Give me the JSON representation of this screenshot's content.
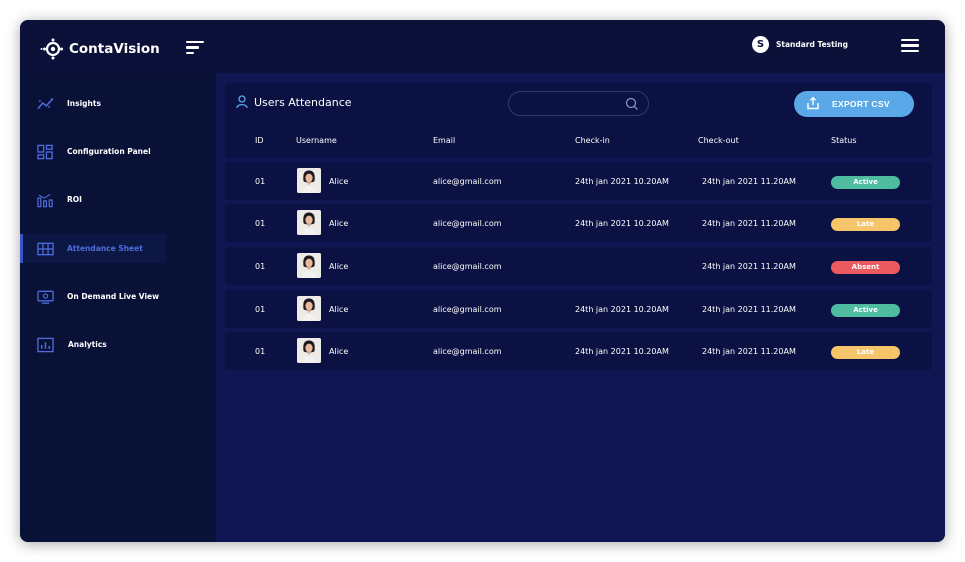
{
  "app": {
    "name": "ContaVision"
  },
  "user": {
    "initial": "S",
    "name": "Standard Testing"
  },
  "sidebar": {
    "items": [
      {
        "label": "Insights",
        "icon": "insights-icon",
        "active": false
      },
      {
        "label": "Configuration Panel",
        "icon": "configuration-icon",
        "active": false
      },
      {
        "label": "ROI",
        "icon": "roi-icon",
        "active": false
      },
      {
        "label": "Attendance Sheet",
        "icon": "attendance-grid-icon",
        "active": true
      },
      {
        "label": "On  Demand Live View",
        "icon": "live-view-icon",
        "active": false
      },
      {
        "label": "Analytics",
        "icon": "analytics-icon",
        "active": false
      }
    ]
  },
  "main": {
    "title": "Users Attendance",
    "search": {
      "placeholder": "",
      "value": ""
    },
    "export_label": "EXPORT CSV",
    "columns": [
      "ID",
      "Username",
      "Email",
      "Check-in",
      "Check-out",
      "Status"
    ],
    "rows": [
      {
        "id": "01",
        "username": "Alice",
        "email": "alice@gmail.com",
        "checkin": "24th jan 2021  10.20AM",
        "checkout": "24th jan 2021  11.20AM",
        "status": "Active"
      },
      {
        "id": "01",
        "username": "Alice",
        "email": "alice@gmail.com",
        "checkin": "24th jan 2021  10.20AM",
        "checkout": "24th jan 2021  11.20AM",
        "status": "Late"
      },
      {
        "id": "01",
        "username": "Alice",
        "email": "alice@gmail.com",
        "checkin": "",
        "checkout": "24th jan 2021  11.20AM",
        "status": "Absent"
      },
      {
        "id": "01",
        "username": "Alice",
        "email": "alice@gmail.com",
        "checkin": "24th jan 2021  10.20AM",
        "checkout": "24th jan 2021  11.20AM",
        "status": "Active"
      },
      {
        "id": "01",
        "username": "Alice",
        "email": "alice@gmail.com",
        "checkin": "24th jan 2021  10.20AM",
        "checkout": "24th jan 2021  11.20AM",
        "status": "Late"
      }
    ]
  },
  "colors": {
    "accent": "#5aa8e8",
    "active_nav": "#4d6ddf",
    "status": {
      "Active": "#4fbc9f",
      "Late": "#f6c46a",
      "Absent": "#ea5a5f"
    }
  }
}
